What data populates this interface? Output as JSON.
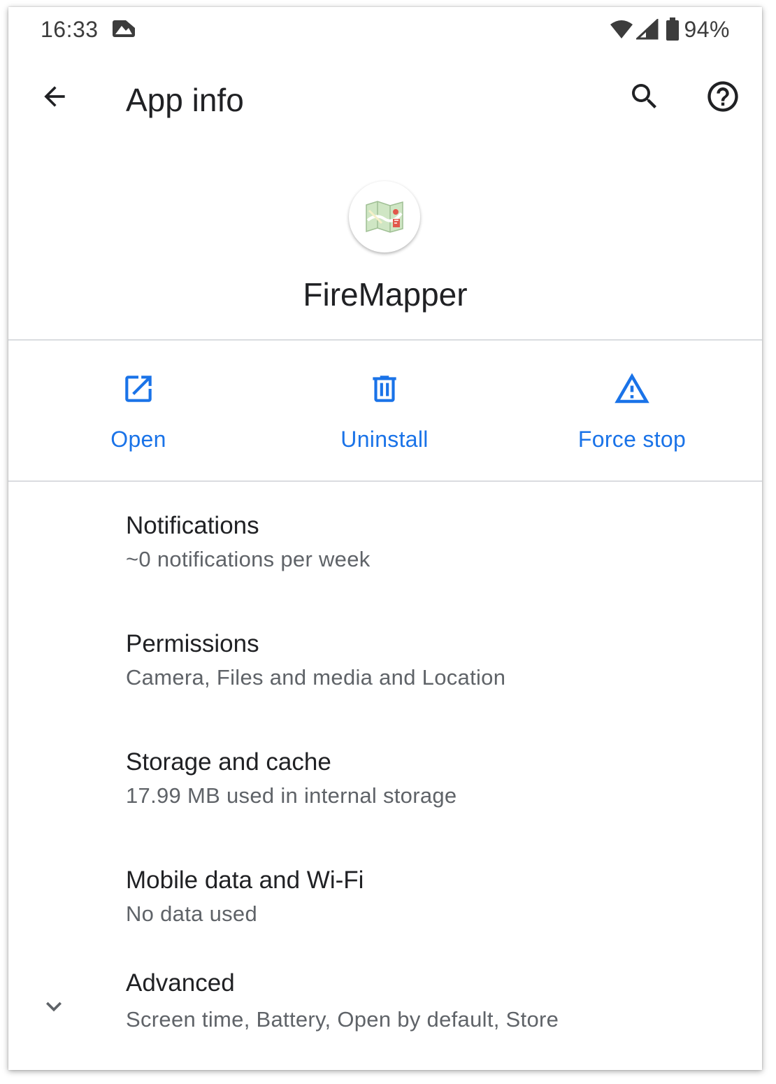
{
  "status_bar": {
    "time": "16:33",
    "notification_icon": "image-icon",
    "wifi_icon": "wifi-icon",
    "signal_icon": "cellular-signal-icon",
    "battery_icon": "battery-icon",
    "battery_percent": "94%"
  },
  "app_bar": {
    "title": "App info",
    "back_icon": "arrow-back-icon",
    "search_icon": "search-icon",
    "help_icon": "help-icon"
  },
  "app": {
    "name": "FireMapper",
    "icon": "map-app-icon"
  },
  "actions": [
    {
      "label": "Open",
      "icon": "open-in-new-icon"
    },
    {
      "label": "Uninstall",
      "icon": "trash-icon"
    },
    {
      "label": "Force stop",
      "icon": "warning-icon"
    }
  ],
  "settings": [
    {
      "title": "Notifications",
      "summary": "~0 notifications per week"
    },
    {
      "title": "Permissions",
      "summary": "Camera, Files and media and Location"
    },
    {
      "title": "Storage and cache",
      "summary": "17.99 MB used in internal storage"
    },
    {
      "title": "Mobile data and Wi-Fi",
      "summary": "No data used"
    },
    {
      "title": "Advanced",
      "summary": "Screen time, Battery, Open by default, Store",
      "expand_icon": "chevron-down-icon"
    }
  ],
  "colors": {
    "accent": "#1a73e8",
    "text_primary": "#202124",
    "text_secondary": "#5f6368",
    "divider": "#dadce0"
  }
}
